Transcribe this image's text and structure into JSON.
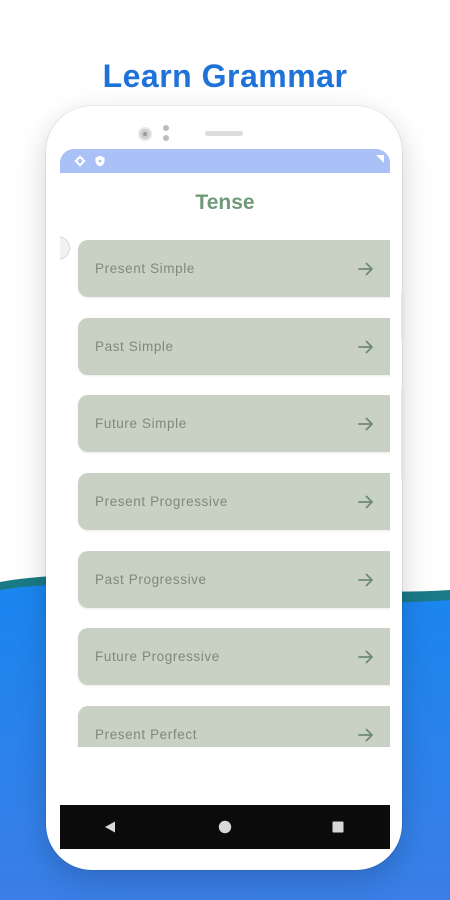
{
  "headline": "Learn Grammar",
  "screen": {
    "title": "Tense",
    "tenses": [
      {
        "label": "Present Simple"
      },
      {
        "label": "Past Simple"
      },
      {
        "label": "Future Simple"
      },
      {
        "label": "Present Progressive"
      },
      {
        "label": "Past Progressive"
      },
      {
        "label": "Future Progressive"
      },
      {
        "label": "Present Perfect"
      }
    ]
  },
  "status_icons": [
    "gear-icon",
    "shield-icon"
  ],
  "nav_icons": [
    "back-triangle-icon",
    "home-circle-icon",
    "recents-square-icon"
  ],
  "colors": {
    "headline": "#1f73d8",
    "background_blue": "#2f86f0",
    "statusbar": "#a9c1f6",
    "title": "#6f9a7a",
    "item_bg": "#c9d1c4",
    "item_text": "#7c8a7c",
    "navbar": "#0b0b0b"
  }
}
